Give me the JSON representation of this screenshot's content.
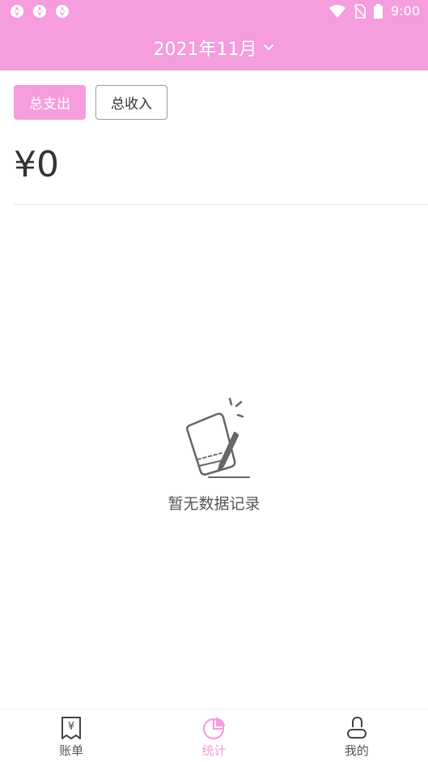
{
  "status_bar": {
    "time": "9:00",
    "notification_icons": [
      "notif-icon",
      "notif-icon",
      "notif-icon"
    ],
    "system_icons": [
      "wifi-icon",
      "no-sim-icon",
      "battery-icon"
    ]
  },
  "header": {
    "month_label": "2021年11月",
    "background_color": "#f59ddd"
  },
  "tabs": [
    {
      "label": "总支出",
      "active": true
    },
    {
      "label": "总收入",
      "active": false
    }
  ],
  "summary": {
    "total": "¥0"
  },
  "empty_state": {
    "icon": "notebook-pen-icon",
    "message": "暂无数据记录"
  },
  "bottom_nav": {
    "items": [
      {
        "label": "账单",
        "icon": "bill-icon",
        "active": false
      },
      {
        "label": "统计",
        "icon": "pie-chart-icon",
        "active": true
      },
      {
        "label": "我的",
        "icon": "profile-icon",
        "active": false
      }
    ],
    "active_color": "#f59ddd"
  }
}
